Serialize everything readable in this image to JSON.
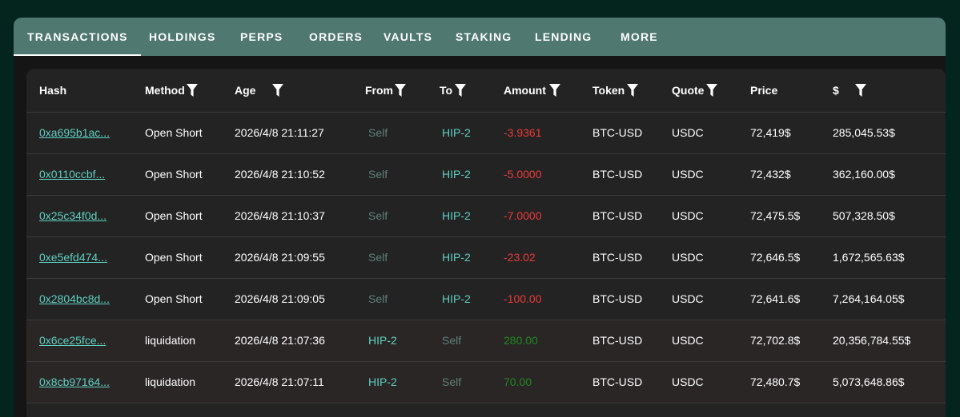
{
  "colors": {
    "background": "#04241e",
    "tabbar": "#4f7870",
    "link": "#5fcfc0",
    "self": "#5e8079",
    "negative": "#ec3a3a",
    "positive": "#1f8a21"
  },
  "tabs": [
    {
      "label": "TRANSACTIONS",
      "active": true
    },
    {
      "label": "HOLDINGS"
    },
    {
      "label": "PERPS"
    },
    {
      "label": "ORDERS"
    },
    {
      "label": "VAULTS"
    },
    {
      "label": "STAKING"
    },
    {
      "label": "LENDING"
    },
    {
      "label": "MORE"
    }
  ],
  "columns": [
    {
      "label": "Hash",
      "filter": false
    },
    {
      "label": "Method",
      "filter": true
    },
    {
      "label": "Age",
      "filter": true
    },
    {
      "label": "From",
      "filter": true
    },
    {
      "label": "To",
      "filter": true
    },
    {
      "label": "Amount",
      "filter": true
    },
    {
      "label": "Token",
      "filter": true
    },
    {
      "label": "Quote",
      "filter": true
    },
    {
      "label": "Price",
      "filter": false
    },
    {
      "label": "$",
      "filter": true
    }
  ],
  "filter_icon": "funnel-icon",
  "rows": [
    {
      "hash": "0xa695b1ac...",
      "method": "Open Short",
      "age": "2026/4/8 21:11:27",
      "from": "Self",
      "to": "HIP-2",
      "amount": "-3.9361",
      "token": "BTC-USD",
      "quote": "USDC",
      "price": "72,419$",
      "usd": "285,045.53$"
    },
    {
      "hash": "0x0110ccbf...",
      "method": "Open Short",
      "age": "2026/4/8 21:10:52",
      "from": "Self",
      "to": "HIP-2",
      "amount": "-5.0000",
      "token": "BTC-USD",
      "quote": "USDC",
      "price": "72,432$",
      "usd": "362,160.00$"
    },
    {
      "hash": "0x25c34f0d...",
      "method": "Open Short",
      "age": "2026/4/8 21:10:37",
      "from": "Self",
      "to": "HIP-2",
      "amount": "-7.0000",
      "token": "BTC-USD",
      "quote": "USDC",
      "price": "72,475.5$",
      "usd": "507,328.50$"
    },
    {
      "hash": "0xe5efd474...",
      "method": "Open Short",
      "age": "2026/4/8 21:09:55",
      "from": "Self",
      "to": "HIP-2",
      "amount": "-23.02",
      "token": "BTC-USD",
      "quote": "USDC",
      "price": "72,646.5$",
      "usd": "1,672,565.63$"
    },
    {
      "hash": "0x2804bc8d...",
      "method": "Open Short",
      "age": "2026/4/8 21:09:05",
      "from": "Self",
      "to": "HIP-2",
      "amount": "-100.00",
      "token": "BTC-USD",
      "quote": "USDC",
      "price": "72,641.6$",
      "usd": "7,264,164.05$"
    },
    {
      "hash": "0x6ce25fce...",
      "method": "liquidation",
      "age": "2026/4/8 21:07:36",
      "from": "HIP-2",
      "to": "Self",
      "amount": "280.00",
      "token": "BTC-USD",
      "quote": "USDC",
      "price": "72,702.8$",
      "usd": "20,356,784.55$"
    },
    {
      "hash": "0x8cb97164...",
      "method": "liquidation",
      "age": "2026/4/8 21:07:11",
      "from": "HIP-2",
      "to": "Self",
      "amount": "70.00",
      "token": "BTC-USD",
      "quote": "USDC",
      "price": "72,480.7$",
      "usd": "5,073,648.86$"
    }
  ]
}
